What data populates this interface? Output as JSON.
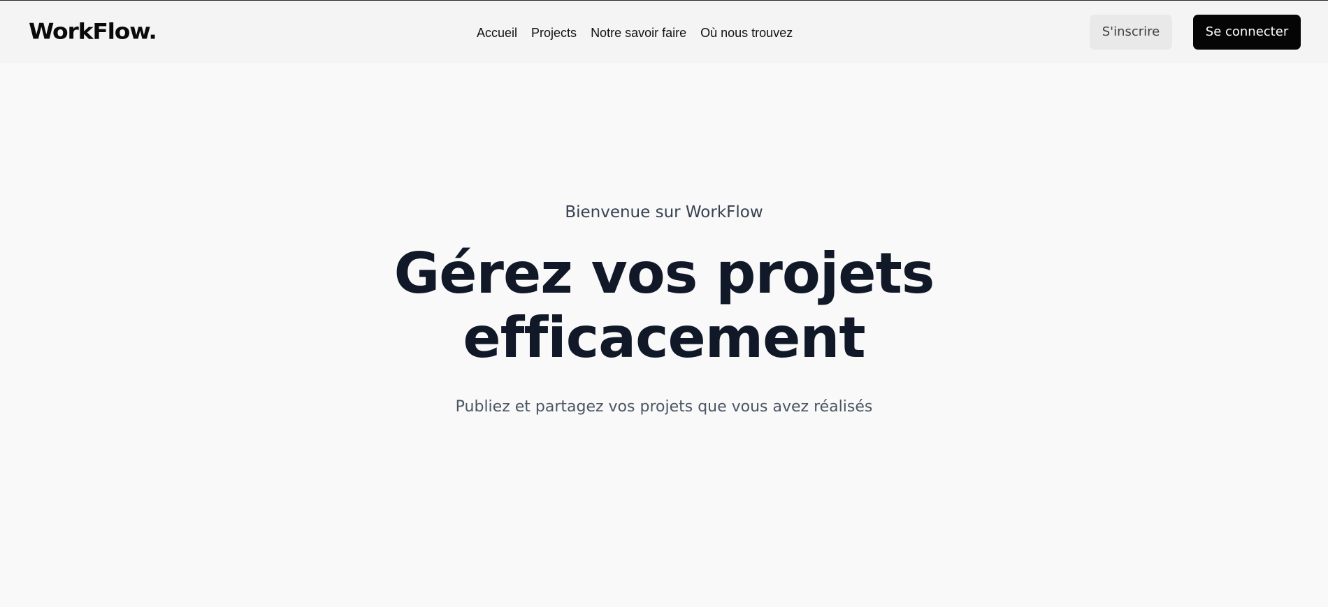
{
  "header": {
    "logo": "WorkFlow.",
    "nav": [
      {
        "label": "Accueil"
      },
      {
        "label": "Projects"
      },
      {
        "label": "Notre savoir faire"
      },
      {
        "label": "Où nous trouvez"
      }
    ],
    "signup_label": "S'inscrire",
    "login_label": "Se connecter"
  },
  "hero": {
    "kicker": "Bienvenue sur WorkFlow",
    "headline_line1": "Gérez vos projets",
    "headline_line2": "efficacement",
    "subtitle": "Publiez et partagez vos projets que vous avez réalisés"
  },
  "colors": {
    "page_background": "#f9f9f9",
    "header_background": "#f4f4f4",
    "primary_button": "#050505",
    "secondary_button": "#e9e9e9",
    "heading_text": "#111827"
  }
}
